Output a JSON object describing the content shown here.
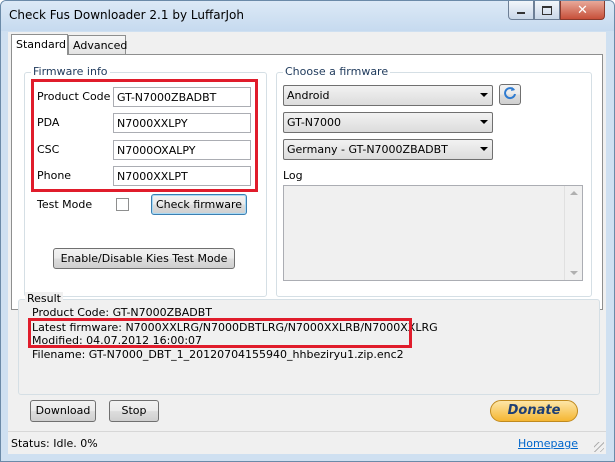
{
  "window": {
    "title": "Check Fus Downloader 2.1 by LuffarJoh",
    "min_label": "—",
    "max_label": "□",
    "close_label": "✕"
  },
  "tabs": [
    {
      "label": "Standard",
      "active": true
    },
    {
      "label": "Advanced",
      "active": false
    }
  ],
  "firmware_info": {
    "group_label": "Firmware info",
    "product_code_label": "Product Code",
    "product_code_value": "GT-N7000ZBADBT",
    "pda_label": "PDA",
    "pda_value": "N7000XXLPY",
    "csc_label": "CSC",
    "csc_value": "N7000OXALPY",
    "phone_label": "Phone",
    "phone_value": "N7000XXLPT",
    "test_mode_label": "Test Mode",
    "test_mode_checked": false,
    "check_firmware_label": "Check firmware",
    "kies_button_label": "Enable/Disable Kies Test Mode"
  },
  "choose_firmware": {
    "group_label": "Choose a firmware",
    "os_value": "Android",
    "model_value": "GT-N7000",
    "region_value": "Germany - GT-N7000ZBADBT",
    "refresh_icon": "refresh-icon",
    "log_label": "Log",
    "log_text": ""
  },
  "result": {
    "group_label": "Result",
    "lines": [
      "Product Code: GT-N7000ZBADBT",
      "Latest firmware: N7000XXLRG/N7000DBTLRG/N7000XXLRB/N7000XXLRG",
      "Modified: 04.07.2012 16:00:07",
      "Filename: GT-N7000_DBT_1_20120704155940_hhbeziryu1.zip.enc2"
    ]
  },
  "actions": {
    "download_label": "Download",
    "stop_label": "Stop",
    "donate_label": "Donate"
  },
  "status": {
    "text": "Status: Idle.  0%",
    "homepage_label": "Homepage"
  },
  "colors": {
    "highlight": "#e01c2b",
    "window_frame": "#cfe0f1",
    "link": "#0066cc"
  }
}
